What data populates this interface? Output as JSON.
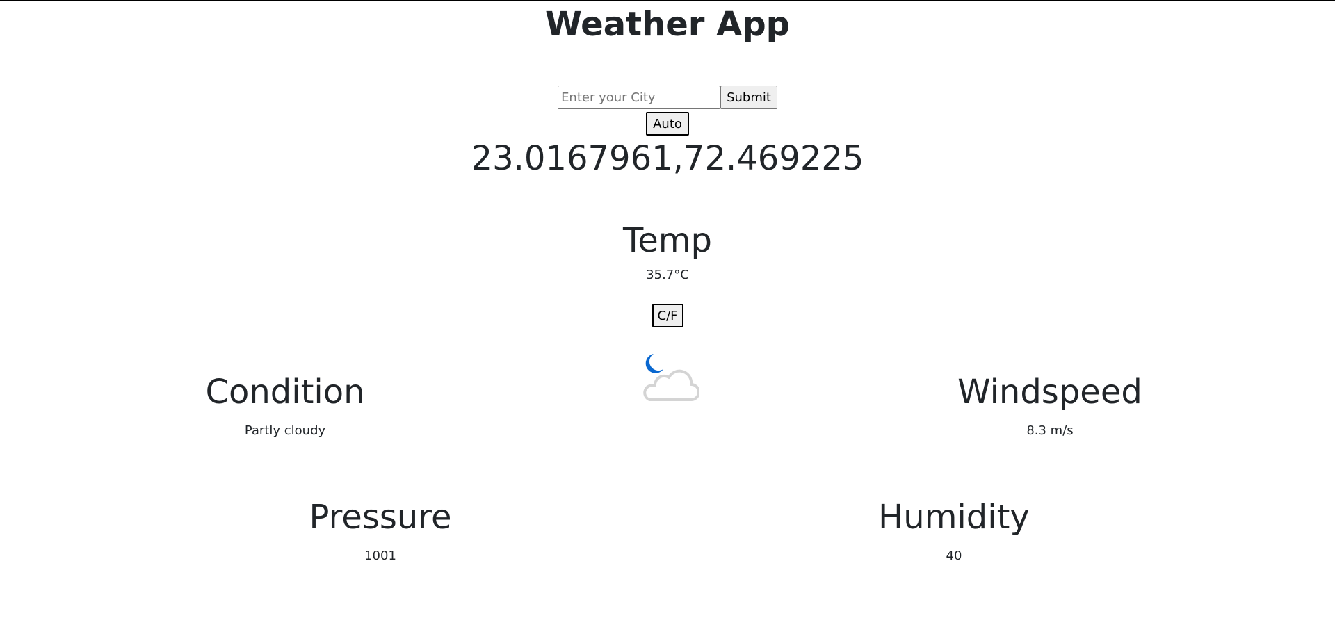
{
  "app": {
    "title": "Weather App"
  },
  "search": {
    "placeholder": "Enter your City",
    "value": "",
    "submit_label": "Submit",
    "auto_label": "Auto"
  },
  "location": {
    "coordinates": "23.0167961,72.469225"
  },
  "temperature": {
    "heading": "Temp",
    "value": "35.7°C",
    "toggle_label": "C/F"
  },
  "weather_icon": {
    "icon": "moon-cloud-icon",
    "moon_color": "#0a68d0",
    "cloud_color": "#d4d4d4"
  },
  "condition": {
    "heading": "Condition",
    "value": "Partly cloudy"
  },
  "windspeed": {
    "heading": "Windspeed",
    "value": "8.3 m/s"
  },
  "pressure": {
    "heading": "Pressure",
    "value": "1001"
  },
  "humidity": {
    "heading": "Humidity",
    "value": "40"
  }
}
